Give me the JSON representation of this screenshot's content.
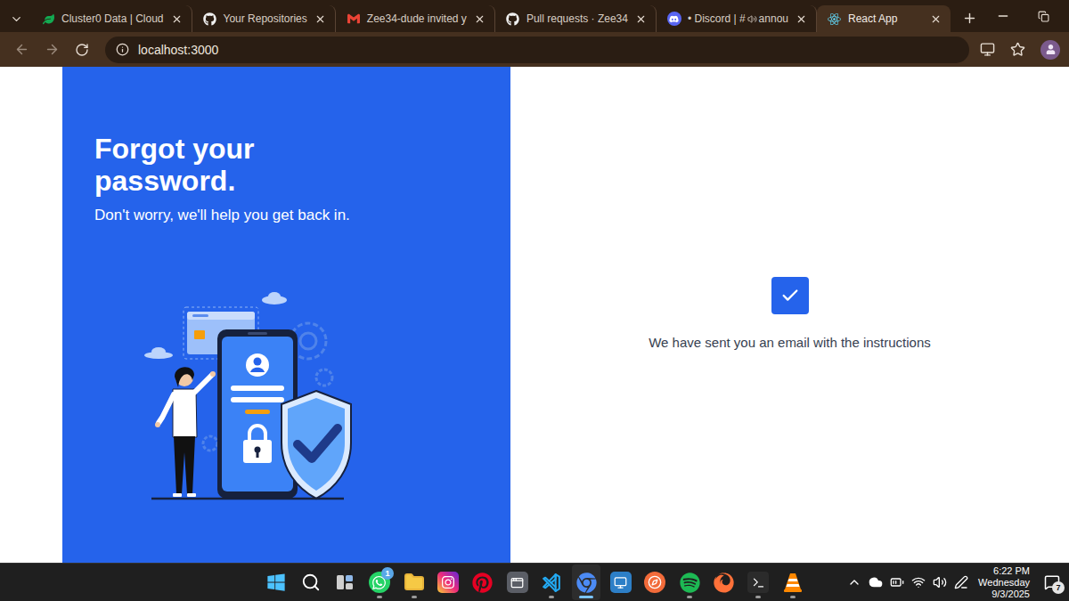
{
  "browser": {
    "tabs": [
      {
        "kind": "mongodb",
        "label": "Cluster0 Data | Cloud",
        "selected": false
      },
      {
        "kind": "github",
        "label": "Your Repositories",
        "selected": false
      },
      {
        "kind": "gmail",
        "label": "Zee34-dude invited y",
        "selected": false
      },
      {
        "kind": "github",
        "label": "Pull requests · Zee34",
        "selected": false
      },
      {
        "kind": "discord",
        "label": "• Discord | #",
        "suffix": "annou",
        "selected": false
      },
      {
        "kind": "react",
        "label": "React App",
        "selected": true
      }
    ],
    "address": "localhost:3000"
  },
  "page": {
    "heading": "Forgot your password.",
    "subheading": "Don't worry, we'll help you get back in.",
    "message": "We have sent you an email with the instructions"
  },
  "taskbar": {
    "apps": [
      {
        "kind": "start",
        "running": false,
        "active": false
      },
      {
        "kind": "search",
        "running": false,
        "active": false
      },
      {
        "kind": "taskview",
        "running": false,
        "active": false
      },
      {
        "kind": "whatsapp",
        "running": true,
        "active": false,
        "badge": "1"
      },
      {
        "kind": "explorer",
        "running": true,
        "active": false
      },
      {
        "kind": "instagram",
        "running": false,
        "active": false
      },
      {
        "kind": "pinterest",
        "running": false,
        "active": false
      },
      {
        "kind": "app",
        "running": false,
        "active": false
      },
      {
        "kind": "vscode",
        "running": true,
        "active": false
      },
      {
        "kind": "chrome",
        "running": true,
        "active": true
      },
      {
        "kind": "remote",
        "running": false,
        "active": false
      },
      {
        "kind": "compass",
        "running": false,
        "active": false
      },
      {
        "kind": "spotify",
        "running": true,
        "active": false
      },
      {
        "kind": "firefox",
        "running": false,
        "active": false
      },
      {
        "kind": "terminal",
        "running": true,
        "active": false
      },
      {
        "kind": "vlc",
        "running": true,
        "active": false
      }
    ],
    "tray": [
      {
        "kind": "chevron"
      },
      {
        "kind": "onedrive"
      },
      {
        "kind": "battery"
      },
      {
        "kind": "wifi"
      },
      {
        "kind": "volume"
      },
      {
        "kind": "pen"
      }
    ],
    "clock": {
      "time": "6:22 PM",
      "day": "Wednesday",
      "date": "9/3/2025"
    },
    "notifications": "7"
  }
}
